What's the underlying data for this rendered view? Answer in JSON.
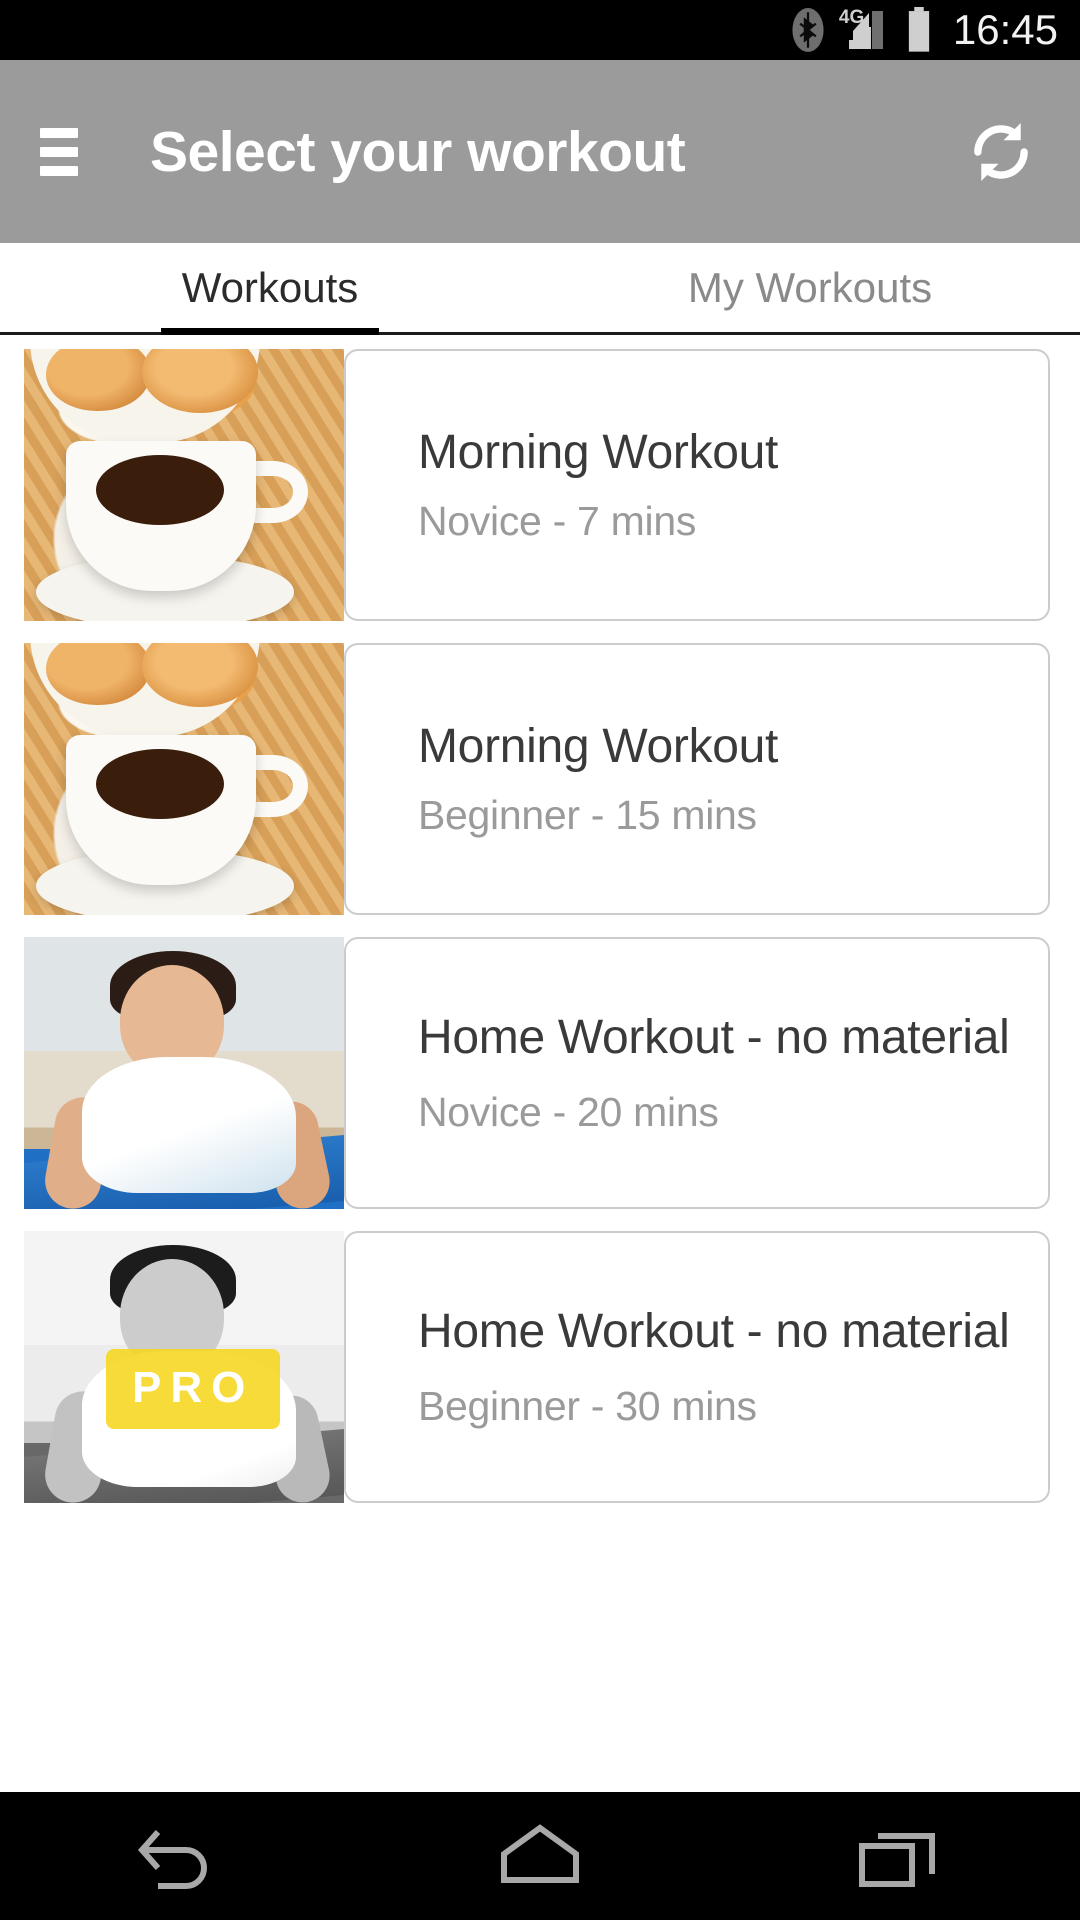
{
  "status_bar": {
    "time": "16:45",
    "network_label": "4G",
    "icons": [
      "bluetooth-icon",
      "signal-icon",
      "battery-icon"
    ]
  },
  "app_bar": {
    "menu_icon": "hamburger-menu-icon",
    "title": "Select your workout",
    "refresh_icon": "refresh-sync-icon",
    "background_color": "#9b9b9b"
  },
  "tabs": [
    {
      "label": "Workouts",
      "active": true
    },
    {
      "label": "My Workouts",
      "active": false
    }
  ],
  "workouts": [
    {
      "title": "Morning Workout",
      "subtitle": "Novice - 7 mins",
      "level": "Novice",
      "duration": "7 mins",
      "image": "coffee-and-pastries-photo",
      "pro": false
    },
    {
      "title": "Morning Workout",
      "subtitle": "Beginner - 15 mins",
      "level": "Beginner",
      "duration": "15 mins",
      "image": "coffee-and-pastries-photo",
      "pro": false
    },
    {
      "title": "Home Workout - no material",
      "subtitle": "Novice - 20 mins",
      "level": "Novice",
      "duration": "20 mins",
      "image": "man-doing-pushup-photo",
      "pro": false
    },
    {
      "title": "Home Workout - no material",
      "subtitle": "Beginner - 30 mins",
      "level": "Beginner",
      "duration": "30 mins",
      "image": "man-doing-pushup-photo-grayscale",
      "pro": true,
      "pro_label": "PRO"
    }
  ],
  "colors": {
    "accent_pro": "#f5d61e",
    "app_bar": "#9b9b9b",
    "card_border": "#cccccc",
    "title_text": "#3a3a3a",
    "subtitle_text": "#9a9a9a",
    "tab_active": "#2b2b2b",
    "tab_inactive": "#8a8a8a"
  },
  "nav_bar": {
    "back": "back-icon",
    "home": "home-icon",
    "recents": "recents-icon"
  }
}
